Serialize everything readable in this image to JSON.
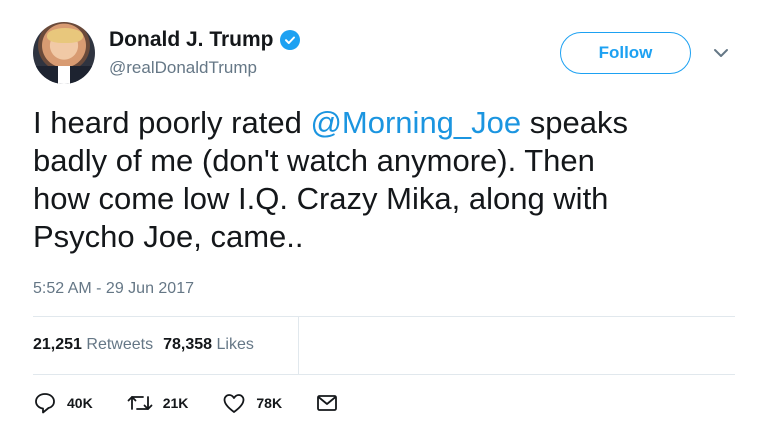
{
  "user": {
    "display_name": "Donald J. Trump",
    "handle": "@realDonaldTrump",
    "verified": true
  },
  "follow_label": "Follow",
  "tweet": {
    "text_before": "I heard poorly rated ",
    "mention": "@Morning_Joe",
    "text_after": " speaks\nbadly of me (don't watch anymore). Then\nhow come low I.Q. Crazy Mika, along with\nPsycho Joe, came..",
    "timestamp": "5:52 AM - 29 Jun 2017"
  },
  "stats": {
    "retweets_count": "21,251",
    "retweets_label": "Retweets",
    "likes_count": "78,358",
    "likes_label": "Likes"
  },
  "actions": {
    "reply_count": "40K",
    "retweet_count": "21K",
    "like_count": "78K"
  },
  "colors": {
    "accent": "#1da1f2",
    "mention": "#1b95e0",
    "secondary_text": "#657786",
    "divider": "#e1e8ed"
  },
  "icons": {
    "verified": "verified-badge-icon",
    "menu": "chevron-down-icon",
    "reply": "reply-icon",
    "retweet": "retweet-icon",
    "like": "heart-icon",
    "message": "envelope-icon"
  }
}
